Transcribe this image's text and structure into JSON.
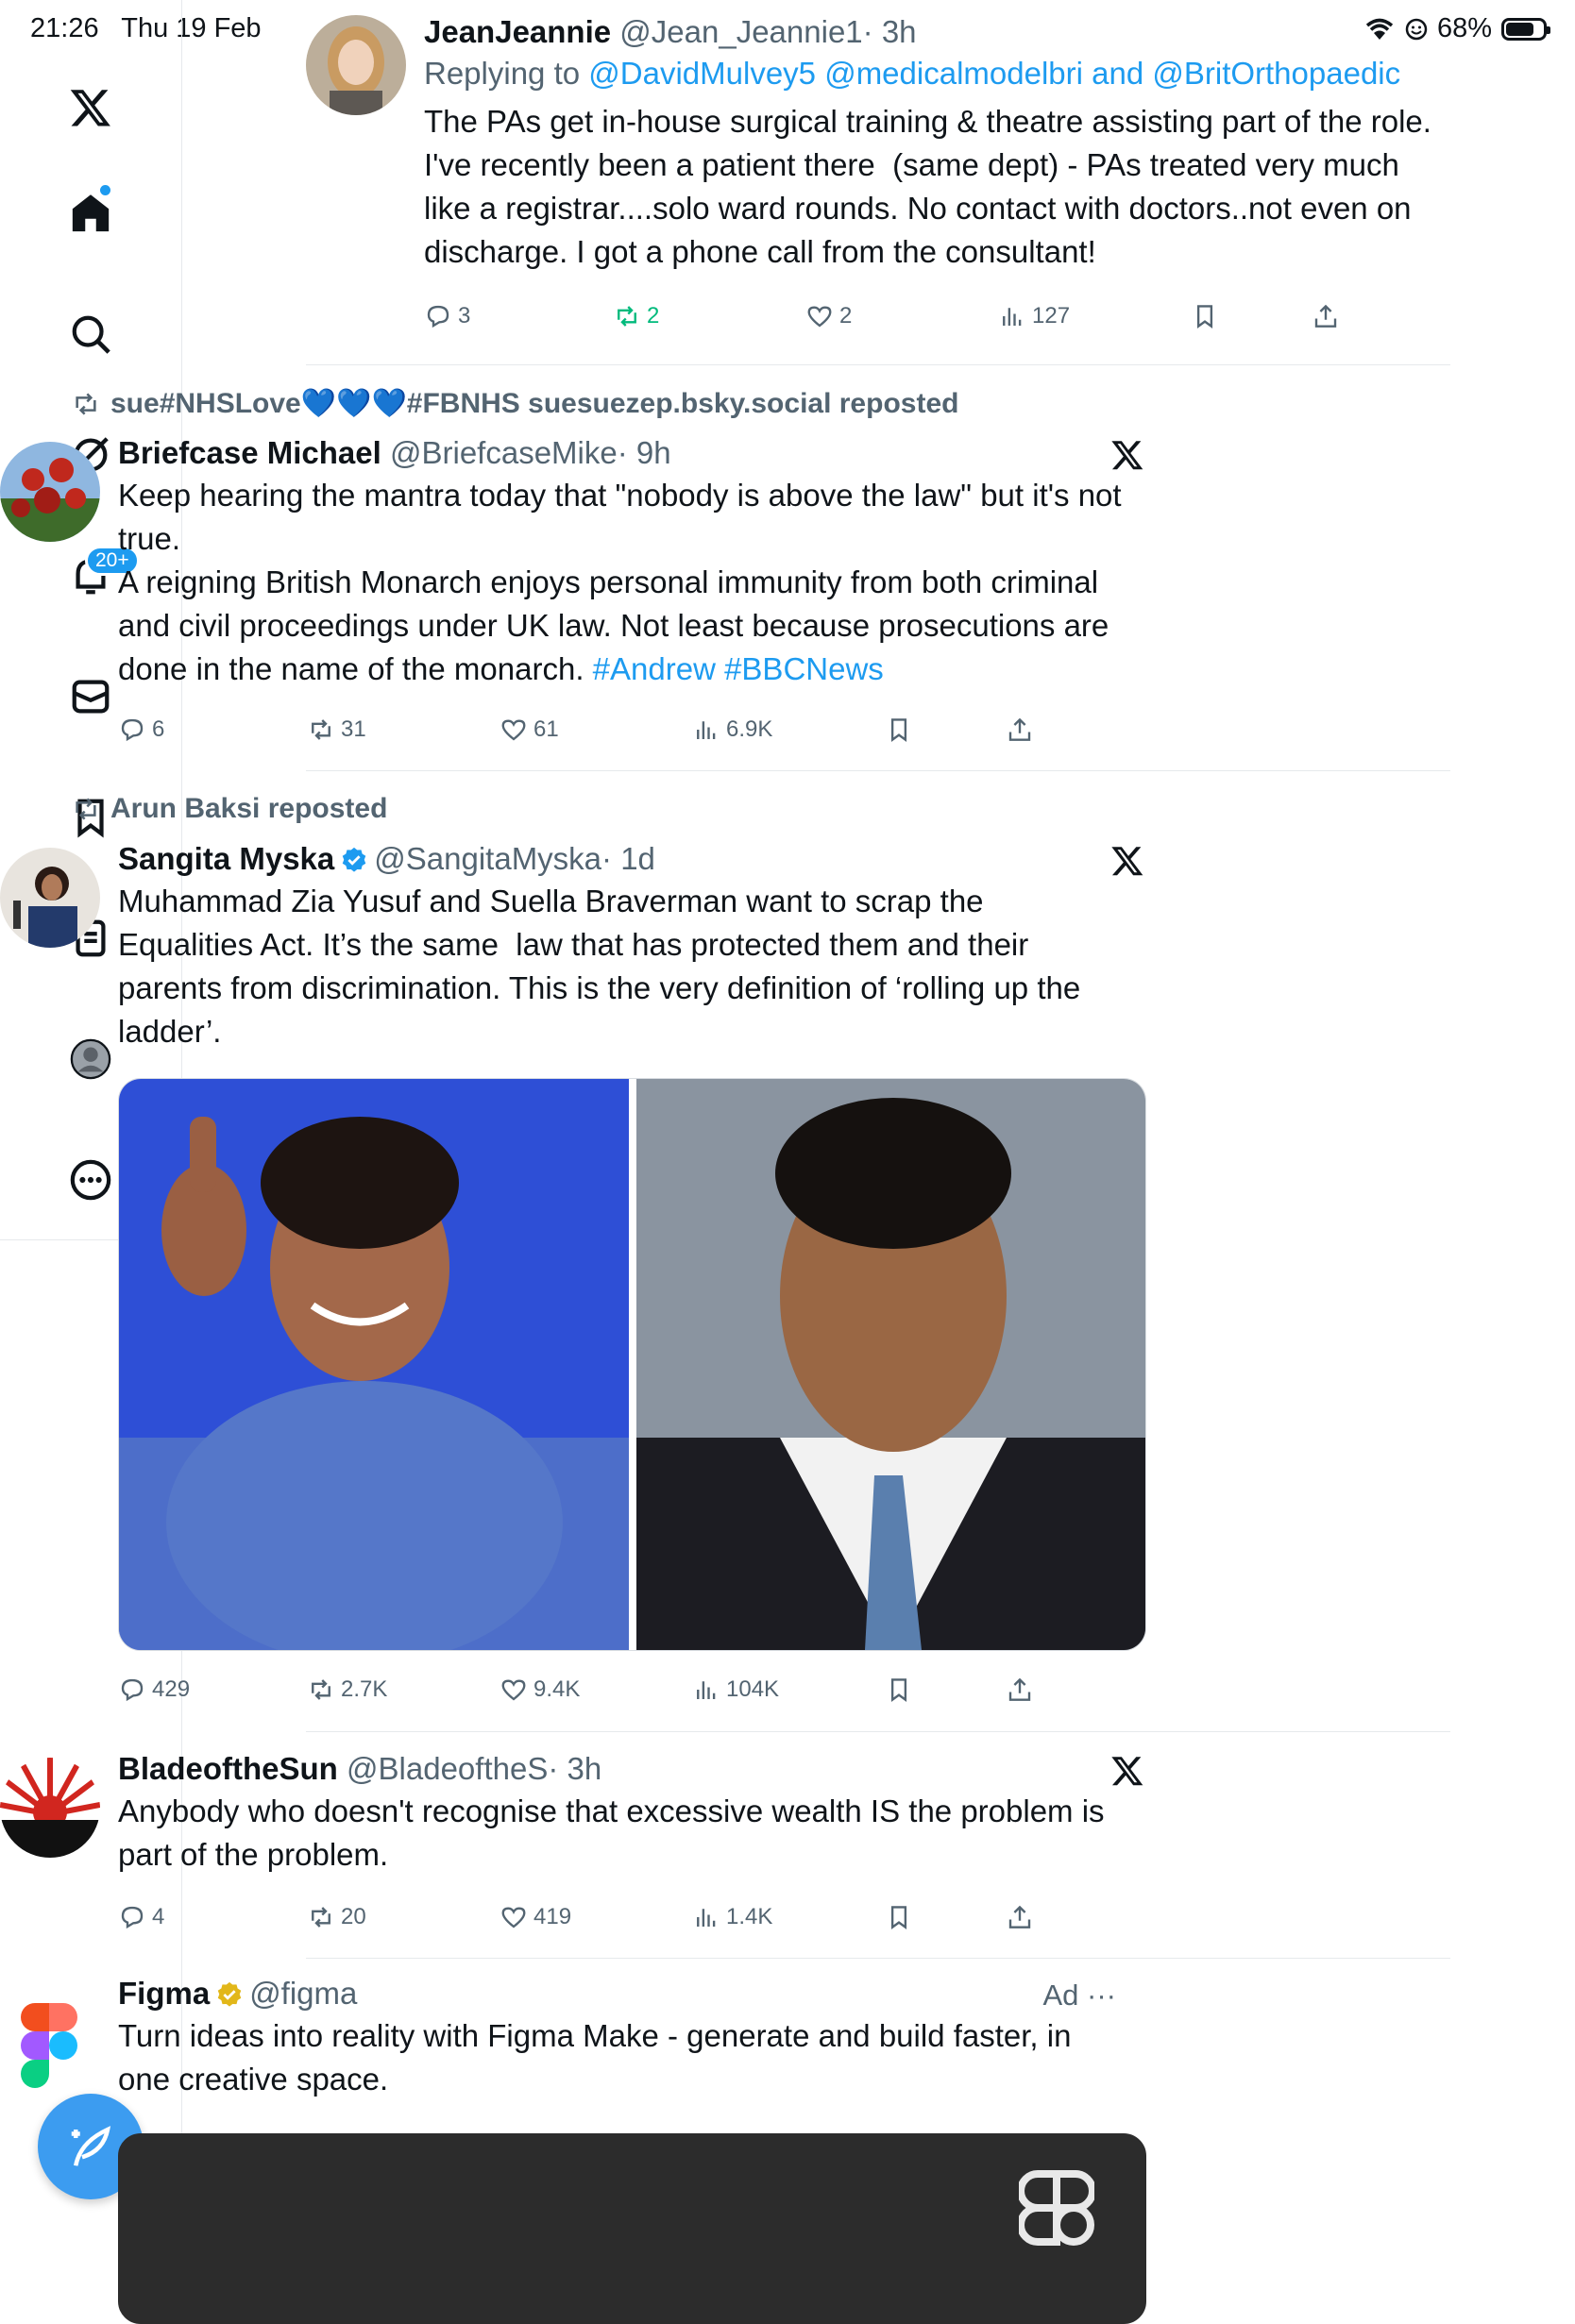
{
  "status": {
    "time": "21:26",
    "date": "Thu 19 Feb",
    "battery": "68%",
    "battery_level": 0.68
  },
  "sidebar": {
    "items": [
      "x-logo",
      "home-icon",
      "search-icon",
      "grok-icon",
      "notifications-icon",
      "messages-icon",
      "bookmarks-icon",
      "lists-icon",
      "profile-icon",
      "more-icon"
    ],
    "notif_badge": "20+"
  },
  "accent": "#1d9bf0",
  "tweets": [
    {
      "name": "JeanJeannie",
      "handle": "@Jean_Jeannie1",
      "time": "· 3h",
      "reply_label": "Replying to",
      "reply_mentions": "@DavidMulvey5 @medicalmodelbri and @BritOrthopaedic",
      "text": "The PAs get in-house surgical training & theatre assisting part of the role. I've recently been a patient there  (same dept) - PAs treated very much like a registrar....solo ward rounds. No contact with doctors..not even on discharge. I got a phone call from the consultant!",
      "replies": "3",
      "reposts": "2",
      "likes": "2",
      "views": "127"
    },
    {
      "repost_by": "sue#NHSLove💙💙💙#FBNHS suesuezep.bsky.social reposted",
      "name": "Briefcase Michael",
      "handle": "@BriefcaseMike",
      "time": "· 9h",
      "text_main": "Keep hearing the mantra today that \"nobody is above the law\" but it's not true.\nA reigning British Monarch enjoys personal immunity from both criminal and civil proceedings under UK law. Not least because prosecutions are done in the name of the monarch. ",
      "hashtags": "#Andrew #BBCNews",
      "replies": "6",
      "reposts": "31",
      "likes": "61",
      "views": "6.9K"
    },
    {
      "repost_by": "Arun Baksi reposted",
      "name": "Sangita Myska",
      "handle": "@SangitaMyska",
      "time": "· 1d",
      "text": "Muhammad Zia Yusuf and Suella Braverman want to scrap the Equalities Act. It’s the same  law that has protected them and their parents from discrimination. This is the very definition of ‘rolling up the ladder’.",
      "replies": "429",
      "reposts": "2.7K",
      "likes": "9.4K",
      "views": "104K"
    },
    {
      "name": "BladeoftheSun",
      "handle": "@BladeoftheS",
      "time": "· 3h",
      "text": "Anybody who doesn't recognise that excessive wealth IS the problem is part of the problem.",
      "replies": "4",
      "reposts": "20",
      "likes": "419",
      "views": "1.4K"
    },
    {
      "name": "Figma",
      "handle": "@figma",
      "ad_label": "Ad ···",
      "text": "Turn ideas into reality with Figma Make - generate and build faster, in one creative space."
    }
  ]
}
